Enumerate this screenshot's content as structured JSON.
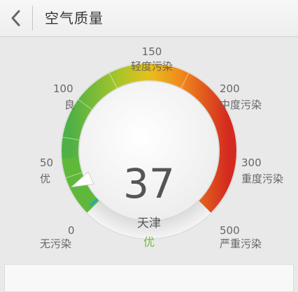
{
  "header": {
    "title": "空气质量",
    "back_icon": "chevron-left-icon"
  },
  "gauge": {
    "aqi": "37",
    "city": "天津",
    "level": "优",
    "level_color": "#6cbf3c",
    "min": 0,
    "max": 500,
    "fraction": 0.074,
    "scale": [
      {
        "value": "0",
        "label": "无污染"
      },
      {
        "value": "50",
        "label": "优"
      },
      {
        "value": "100",
        "label": "良"
      },
      {
        "value": "150",
        "label": "轻度污染"
      },
      {
        "value": "200",
        "label": "中度污染"
      },
      {
        "value": "300",
        "label": "重度污染"
      },
      {
        "value": "500",
        "label": "严重污染"
      }
    ],
    "colors": {
      "green": "#5fb83a",
      "yellow": "#e6c21a",
      "orange": "#ef8a1c",
      "red": "#d42a1f"
    }
  }
}
